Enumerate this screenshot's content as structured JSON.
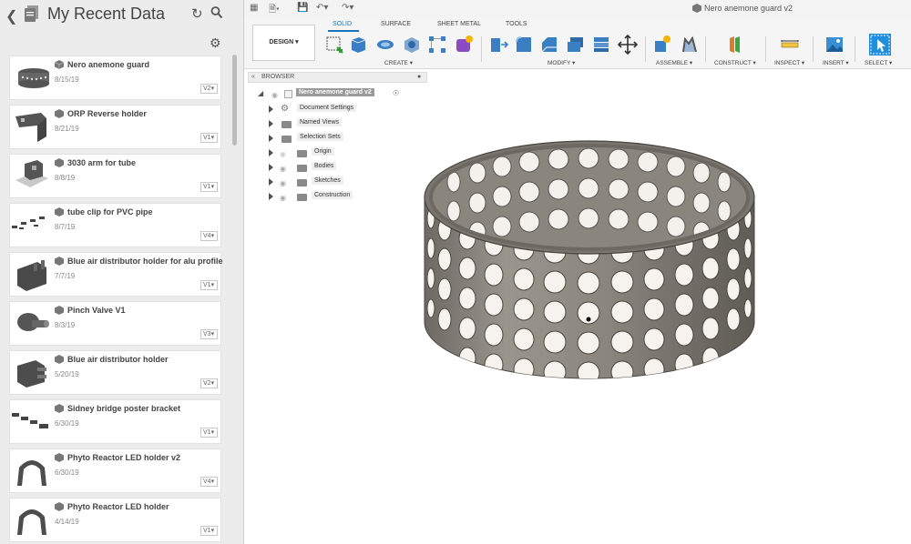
{
  "data_panel": {
    "title": "My Recent Data",
    "items": [
      {
        "name": "Nero anemone guard",
        "date": "8/15/19",
        "version": "V2"
      },
      {
        "name": "ORP Reverse holder",
        "date": "8/21/19",
        "version": "V1"
      },
      {
        "name": "3030 arm for tube",
        "date": "8/8/19",
        "version": "V1"
      },
      {
        "name": "tube clip for PVC pipe",
        "date": "8/7/19",
        "version": "V4"
      },
      {
        "name": "Blue air distributor holder for alu profile",
        "date": "7/7/19",
        "version": "V1"
      },
      {
        "name": "Pinch Valve V1",
        "date": "8/3/19",
        "version": "V3"
      },
      {
        "name": "Blue air distributor holder",
        "date": "5/20/19",
        "version": "V2"
      },
      {
        "name": "Sidney bridge poster bracket",
        "date": "6/30/19",
        "version": "V1"
      },
      {
        "name": "Phyto Reactor LED holder v2",
        "date": "6/30/19",
        "version": "V4"
      },
      {
        "name": "Phyto Reactor LED holder",
        "date": "4/14/19",
        "version": "V1"
      }
    ]
  },
  "document": {
    "title": "Nero anemone guard v2"
  },
  "ribbon": {
    "workspace": "DESIGN",
    "tabs": [
      "SOLID",
      "SURFACE",
      "SHEET METAL",
      "TOOLS"
    ],
    "groups": [
      "CREATE",
      "MODIFY",
      "ASSEMBLE",
      "CONSTRUCT",
      "INSPECT",
      "INSERT",
      "SELECT"
    ]
  },
  "browser": {
    "label": "BROWSER",
    "root": "Nero anemone guard v2",
    "nodes": [
      "Document Settings",
      "Named Views",
      "Selection Sets",
      "Origin",
      "Bodies",
      "Sketches",
      "Construction"
    ]
  },
  "colors": {
    "accent": "#1a73b6",
    "model": "#8d877e",
    "panel_bg": "#ececec"
  }
}
